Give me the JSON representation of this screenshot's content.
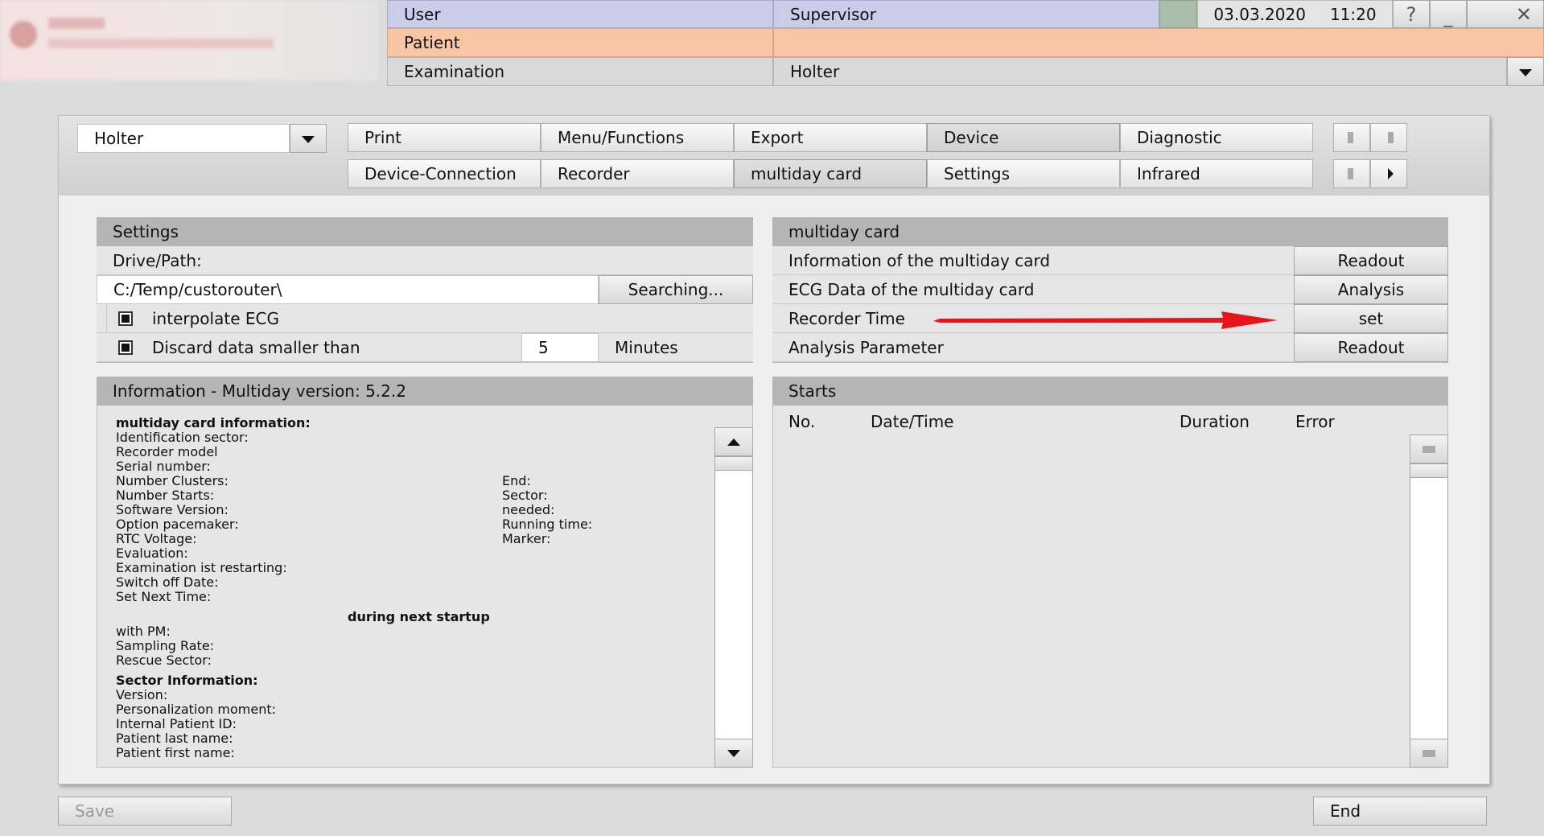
{
  "header": {
    "user_label": "User",
    "user_value": "Supervisor",
    "patient_label": "Patient",
    "patient_value": "",
    "exam_label": "Examination",
    "exam_value": "Holter",
    "date": "03.03.2020",
    "time": "11:20",
    "help_icon": "?",
    "minimize_icon": "_",
    "close_icon": "✕",
    "status_color": "#a9bfa9"
  },
  "toolbar": {
    "module_select": "Holter",
    "tabs_row1": [
      "Print",
      "Menu/Functions",
      "Export",
      "Device",
      "Diagnostic"
    ],
    "tabs_row2": [
      "Device-Connection",
      "Recorder",
      "multiday card",
      "Settings",
      "Infrared"
    ],
    "selected_row1": "Device",
    "selected_row2": "multiday card"
  },
  "settings": {
    "title": "Settings",
    "drive_label": "Drive/Path:",
    "path_value": "C:/Temp/custorouter\\",
    "search_button": "Searching...",
    "interpolate_label": "interpolate ECG",
    "interpolate_checked": true,
    "discard_label": "Discard data smaller than",
    "discard_checked": true,
    "discard_value": "5",
    "discard_unit": "Minutes"
  },
  "multiday": {
    "title": "multiday card",
    "rows": [
      {
        "label": "Information of the multiday card",
        "button": "Readout"
      },
      {
        "label": "ECG Data of the multiday card",
        "button": "Analysis"
      },
      {
        "label": "Recorder Time",
        "button": "set"
      },
      {
        "label": "Analysis Parameter",
        "button": "Readout"
      }
    ],
    "annotation_color": "#e8141b"
  },
  "info": {
    "title": "Information - Multiday version: 5.2.2",
    "heading1": "multiday card information:",
    "left_lines": [
      "Identification sector:",
      "Recorder model",
      "Serial number:",
      "Number Clusters:",
      "Number Starts:",
      "Software Version:",
      "Option pacemaker:",
      "RTC Voltage:",
      "Evaluation:",
      "Examination ist restarting:",
      "Switch off Date:",
      "Set Next Time:"
    ],
    "right_lines": [
      "End:",
      "Sector:",
      "needed:",
      "Running time:",
      "Marker:"
    ],
    "next_startup": "during next startup",
    "startup_lines": [
      "with PM:",
      "Sampling Rate:",
      "Rescue Sector:"
    ],
    "heading2": "Sector Information:",
    "sector_lines": [
      "Version:",
      "Personalization moment:",
      "Internal Patient ID:",
      "Patient last name:",
      "Patient first name:"
    ]
  },
  "starts": {
    "title": "Starts",
    "columns": [
      "No.",
      "Date/Time",
      "Duration",
      "Error"
    ]
  },
  "footer": {
    "save_button": "Save",
    "end_button": "End"
  }
}
